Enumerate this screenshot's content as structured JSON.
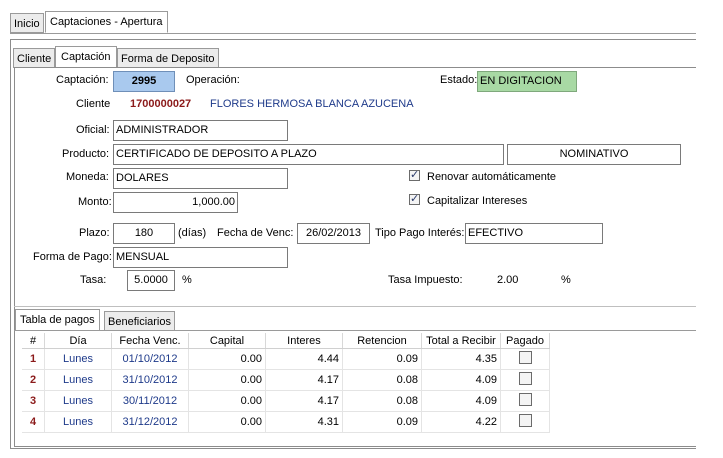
{
  "window_tabs": [
    "Inicio",
    "Captaciones - Apertura"
  ],
  "form_tabs": [
    "Cliente",
    "Captación",
    "Forma de Deposito"
  ],
  "fields": {
    "captacion_label": "Captación:",
    "captacion_value": "2995",
    "operacion_label": "Operación:",
    "estado_label": "Estado:",
    "estado_value": "EN DIGITACION",
    "cliente_label": "Cliente",
    "cliente_id": "1700000027",
    "cliente_name": "FLORES HERMOSA BLANCA AZUCENA",
    "oficial_label": "Oficial:",
    "oficial_value": "ADMINISTRADOR",
    "producto_label": "Producto:",
    "producto_value": "CERTIFICADO DE DEPOSITO A PLAZO",
    "producto_tipo": "NOMINATIVO",
    "moneda_label": "Moneda:",
    "moneda_value": "DOLARES",
    "renovar_label": "Renovar automáticamente",
    "renovar_checked": true,
    "monto_label": "Monto:",
    "monto_value": "1,000.00",
    "capitalizar_label": "Capitalizar Intereses",
    "capitalizar_checked": true,
    "plazo_label": "Plazo:",
    "plazo_value": "180",
    "plazo_unit": "(días)",
    "fecha_venc_label": "Fecha de Venc:",
    "fecha_venc_value": "26/02/2013",
    "tipo_pago_label": "Tipo Pago Interés:",
    "tipo_pago_value": "EFECTIVO",
    "forma_pago_label": "Forma de Pago:",
    "forma_pago_value": "MENSUAL",
    "tasa_label": "Tasa:",
    "tasa_value": "5.0000",
    "tasa_unit": "%",
    "tasa_impuesto_label": "Tasa Impuesto:",
    "tasa_impuesto_value": "2.00",
    "tasa_impuesto_unit": "%"
  },
  "lower_tabs": [
    "Tabla de pagos",
    "Beneficiarios"
  ],
  "table": {
    "headers": [
      "#",
      "Día",
      "Fecha Venc.",
      "Capital",
      "Interes",
      "Retencion",
      "Total a Recibir",
      "Pagado"
    ],
    "rows": [
      {
        "n": "1",
        "dia": "Lunes",
        "fecha": "01/10/2012",
        "capital": "0.00",
        "interes": "4.44",
        "retencion": "0.09",
        "total": "4.35",
        "pagado": false
      },
      {
        "n": "2",
        "dia": "Lunes",
        "fecha": "31/10/2012",
        "capital": "0.00",
        "interes": "4.17",
        "retencion": "0.08",
        "total": "4.09",
        "pagado": false
      },
      {
        "n": "3",
        "dia": "Lunes",
        "fecha": "30/11/2012",
        "capital": "0.00",
        "interes": "4.17",
        "retencion": "0.08",
        "total": "4.09",
        "pagado": false
      },
      {
        "n": "4",
        "dia": "Lunes",
        "fecha": "31/12/2012",
        "capital": "0.00",
        "interes": "4.31",
        "retencion": "0.09",
        "total": "4.22",
        "pagado": false
      }
    ]
  },
  "colors": {
    "captacion_bg": "#a9c9ee",
    "estado_bg": "#a8d9a4",
    "id_red": "#8b1a1a",
    "name_blue": "#1e3a8a"
  }
}
